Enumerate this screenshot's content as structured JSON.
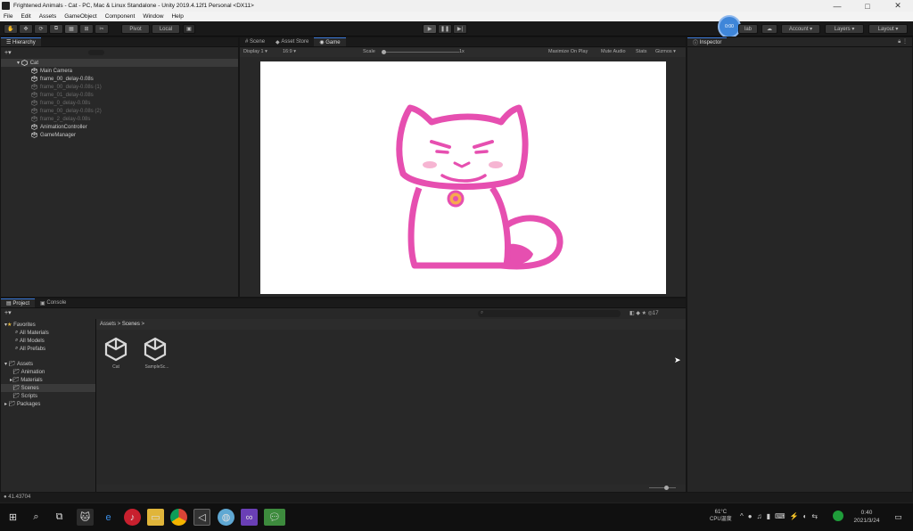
{
  "window": {
    "title": "Frightened Animals - Cat - PC, Mac & Linux Standalone - Unity 2019.4.12f1 Personal <DX11>",
    "controls": [
      "—",
      "□",
      "✕"
    ]
  },
  "menu": [
    "File",
    "Edit",
    "Assets",
    "GameObject",
    "Component",
    "Window",
    "Help"
  ],
  "toolbar": {
    "pivot_label": "Pivot",
    "local_label": "Local",
    "collab_label": "lab",
    "account_label": "Account",
    "layers_label": "Layers",
    "layout_label": "Layout",
    "avatar_text": "0:00"
  },
  "hierarchy": {
    "tab": "Hierarchy",
    "root": "Cat",
    "items": [
      {
        "label": "Main Camera",
        "dim": false
      },
      {
        "label": "frame_00_delay-0.08s",
        "dim": false
      },
      {
        "label": "frame_00_delay-0.08s (1)",
        "dim": true
      },
      {
        "label": "frame_01_delay-0.08s",
        "dim": true
      },
      {
        "label": "frame_0_delay-0.08s",
        "dim": true
      },
      {
        "label": "frame_00_delay-0.08s (2)",
        "dim": true
      },
      {
        "label": "frame_2_delay-0.08s",
        "dim": true
      },
      {
        "label": "AnimationController",
        "dim": false
      },
      {
        "label": "GameManager",
        "dim": false
      }
    ]
  },
  "center": {
    "tabs": [
      "Scene",
      "Asset Store",
      "Game"
    ],
    "display": "Display 1",
    "aspect": "16:9",
    "scale_label": "Scale",
    "scale_value": "1x",
    "options": [
      "Maximize On Play",
      "Mute Audio",
      "Stats",
      "Gizmos"
    ]
  },
  "inspector": {
    "tab": "Inspector"
  },
  "project": {
    "tabs": [
      "Project",
      "Console"
    ],
    "favorites_label": "Favorites",
    "favorites": [
      "All Materials",
      "All Models",
      "All Prefabs"
    ],
    "assets_label": "Assets",
    "asset_folders": [
      "Animation",
      "Materials",
      "Scenes",
      "Scripts"
    ],
    "packages_label": "Packages",
    "breadcrumb": [
      "Assets",
      "Scenes"
    ],
    "files": [
      "Cat",
      "SampleSc..."
    ],
    "count_badge": "17"
  },
  "status": {
    "text": "41.43704"
  },
  "taskbar": {
    "weather": "61°C",
    "weather_sub": "CPU温度",
    "time": "0:40",
    "date": "2021/3/24"
  }
}
